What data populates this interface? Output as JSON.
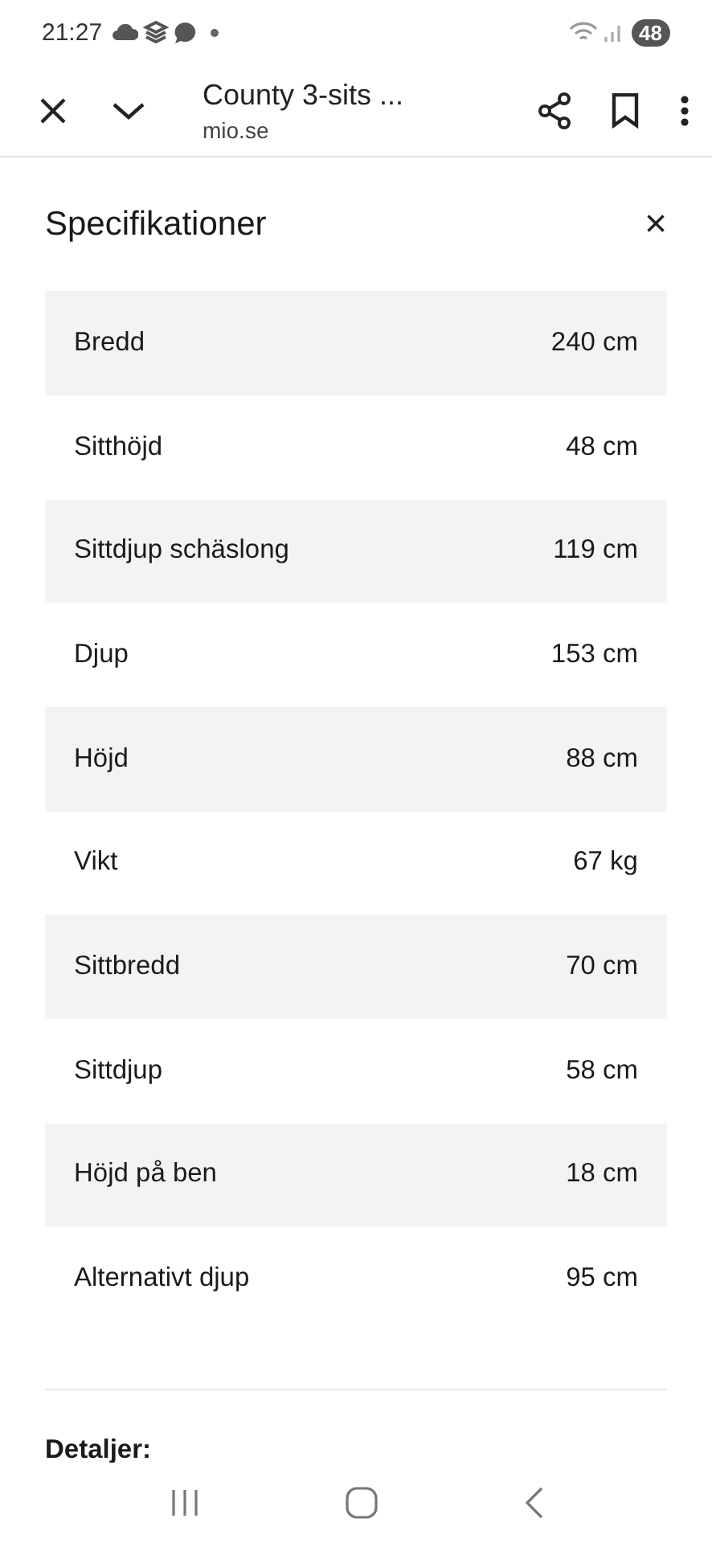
{
  "status_bar": {
    "time": "21:27",
    "battery": "48"
  },
  "toolbar": {
    "title": "County 3-sits ...",
    "url": "mio.se"
  },
  "panel": {
    "title": "Specifikationer",
    "close": "×"
  },
  "specs": [
    {
      "label": "Bredd",
      "value": "240 cm"
    },
    {
      "label": "Sitthöjd",
      "value": "48 cm"
    },
    {
      "label": "Sittdjup schäslong",
      "value": "119 cm"
    },
    {
      "label": "Djup",
      "value": "153 cm"
    },
    {
      "label": "Höjd",
      "value": "88 cm"
    },
    {
      "label": "Vikt",
      "value": "67 kg"
    },
    {
      "label": "Sittbredd",
      "value": "70 cm"
    },
    {
      "label": "Sittdjup",
      "value": "58 cm"
    },
    {
      "label": "Höjd på ben",
      "value": "18 cm"
    },
    {
      "label": "Alternativt djup",
      "value": "95 cm"
    }
  ],
  "details_heading": "Detaljer:"
}
